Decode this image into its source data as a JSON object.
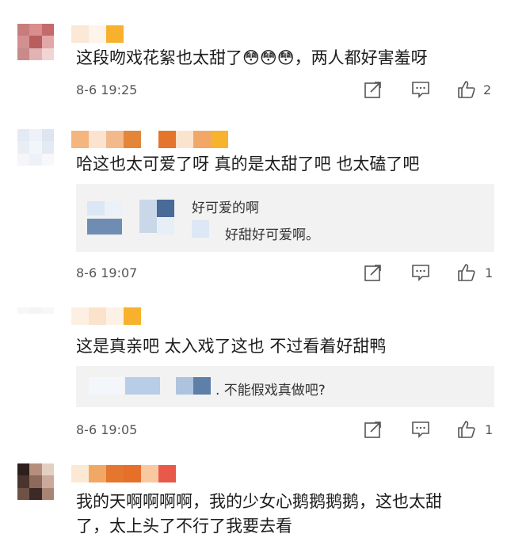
{
  "comments": [
    {
      "text_lines": [
        "这段吻戏花絮也太甜了😳😳😳，两人都好害羞呀"
      ],
      "time": "8-6 19:25",
      "like_count": "2",
      "replies": []
    },
    {
      "text_lines": [
        "哈这也太可爱了呀 真的是太甜了吧 也太磕了吧"
      ],
      "time": "8-6 19:07",
      "like_count": "1",
      "replies": [
        {
          "text": "好可爱的啊"
        },
        {
          "text": "好甜好可爱啊。"
        }
      ]
    },
    {
      "text_lines": [
        "这是真亲吧 太入戏了这也 不过看着好甜鸭"
      ],
      "time": "8-6 19:05",
      "like_count": "1",
      "replies": [
        {
          "text": ". 不能假戏真做吧?"
        }
      ]
    },
    {
      "text_lines": [
        "我的天啊啊啊啊，我的少女心鹅鹅鹅鹅，这也太甜",
        "了，太上头了不行了我要去看"
      ],
      "time": "",
      "like_count": "",
      "replies": []
    }
  ],
  "icons": {
    "share": "share-icon",
    "comment": "comment-icon",
    "like": "thumbs-up-icon"
  },
  "colors": {
    "text": "#1c1c1c",
    "meta": "#555555",
    "reply_bg": "#f2f2f2",
    "icon": "#555555"
  }
}
